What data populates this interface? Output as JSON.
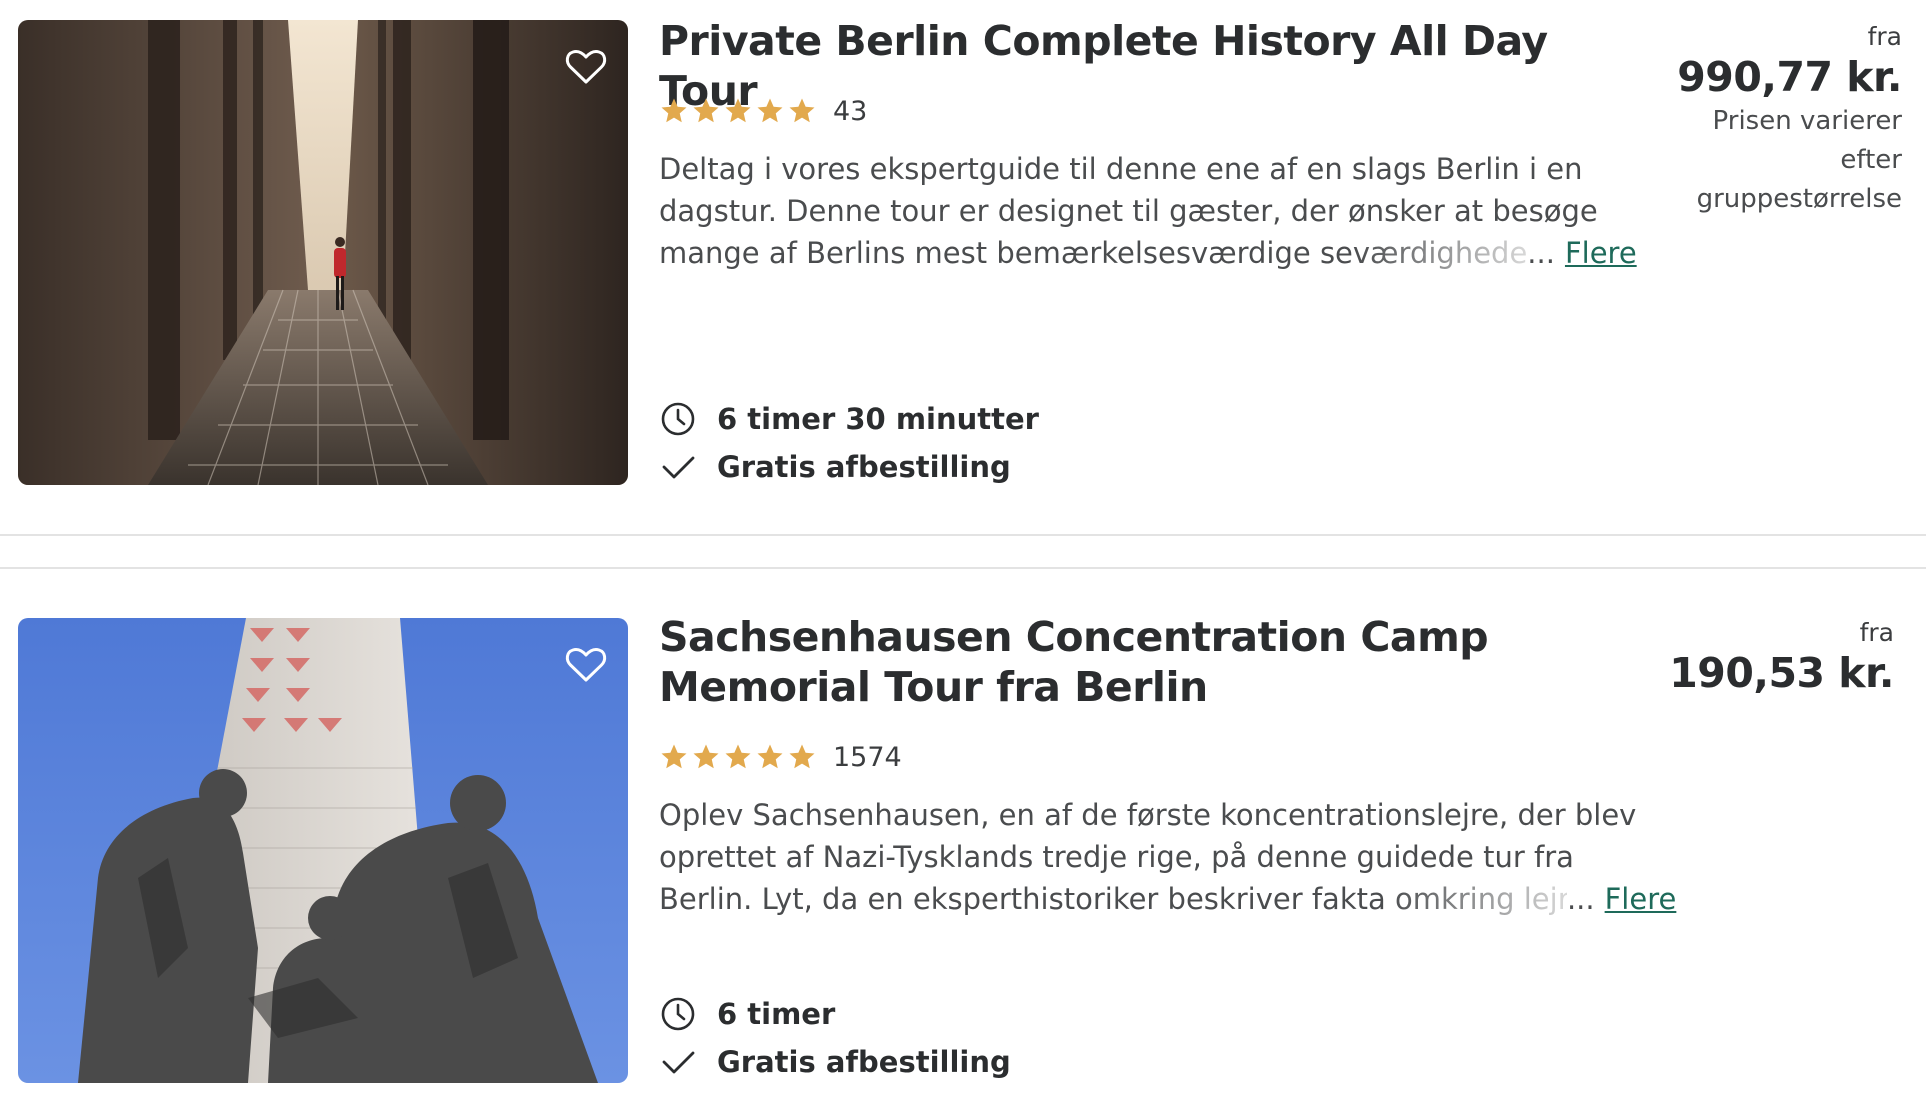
{
  "listings": [
    {
      "title": "Private Berlin Complete History All Day Tour",
      "rating_count": "43",
      "stars": 5,
      "description_lines": [
        "Deltag i vores ekspertguide til denne ene af en slags Berlin i en",
        "dagstur. Denne tour er designet til gæster, der ønsker at besøge",
        "mange af Berlins mest bemærkelsesværdige seværdighede"
      ],
      "ellipsis": "...",
      "more_label": "Flere",
      "duration": "6 timer 30 minutter",
      "cancellation": "Gratis afbestilling",
      "price_from": "fra",
      "price": "990,77 kr.",
      "price_note_lines": [
        "Prisen varierer",
        "efter",
        "gruppestørrelse"
      ],
      "image": "holocaust-memorial-photo"
    },
    {
      "title_lines": [
        "Sachsenhausen Concentration Camp",
        "Memorial Tour fra Berlin"
      ],
      "rating_count": "1574",
      "stars": 5,
      "description_lines": [
        "Oplev Sachsenhausen, en af de første koncentrationslejre, der blev",
        "oprettet af Nazi-Tysklands tredje rige, på denne guidede tur fra",
        "Berlin. Lyt, da en eksperthistoriker beskriver fakta omkring lejr"
      ],
      "ellipsis": "...",
      "more_label": "Flere",
      "duration": "6 timer",
      "cancellation": "Gratis afbestilling",
      "price_from": "fra",
      "price": "190,53 kr.",
      "image": "sachsenhausen-memorial-photo"
    }
  ],
  "colors": {
    "star": "#e2a94d",
    "link": "#1e6a5a",
    "divider": "#e3e3e3",
    "text": "#2b2d2f"
  },
  "icons": {
    "favorite": "heart-outline-icon",
    "duration": "clock-icon",
    "cancellation": "checkmark-icon",
    "rating": "star-icon"
  }
}
